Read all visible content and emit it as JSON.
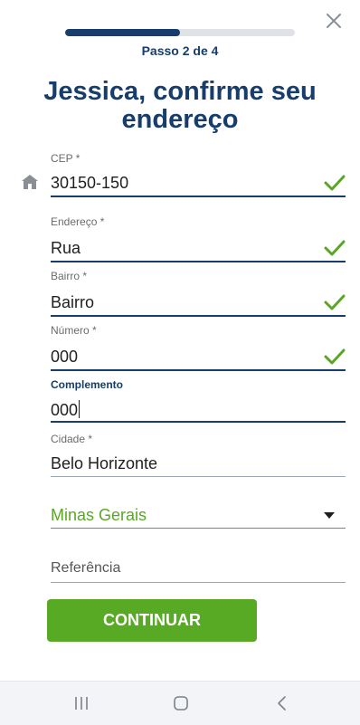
{
  "header": {
    "step_label": "Passo 2 de 4",
    "progress": 0.5,
    "title": "Jessica, confirme seu endereço"
  },
  "form": {
    "cep": {
      "label": "CEP *",
      "value": "30150-150",
      "valid": true
    },
    "endereco": {
      "label": "Endereço *",
      "value": "Rua",
      "valid": true
    },
    "bairro": {
      "label": "Bairro *",
      "value": "Bairro",
      "valid": true
    },
    "numero": {
      "label": "Número *",
      "value": "000",
      "valid": true
    },
    "complemento": {
      "label": "Complemento",
      "value": "000",
      "focused": true
    },
    "cidade": {
      "label": "Cidade *",
      "value": "Belo Horizonte"
    },
    "estado": {
      "value": "Minas Gerais"
    },
    "referencia": {
      "placeholder": "Referência"
    }
  },
  "actions": {
    "continue_label": "CONTINUAR"
  },
  "icons": {
    "close": "close-icon",
    "home": "home-icon",
    "check": "check-icon",
    "dropdown": "dropdown-arrow-icon",
    "nav_recents": "recent-apps-icon",
    "nav_home": "home-nav-icon",
    "nav_back": "back-icon"
  },
  "colors": {
    "brand_blue": "#163d6b",
    "accent_green": "#58a923",
    "check_green": "#5aa626",
    "track_gray": "#dfe2e6"
  }
}
